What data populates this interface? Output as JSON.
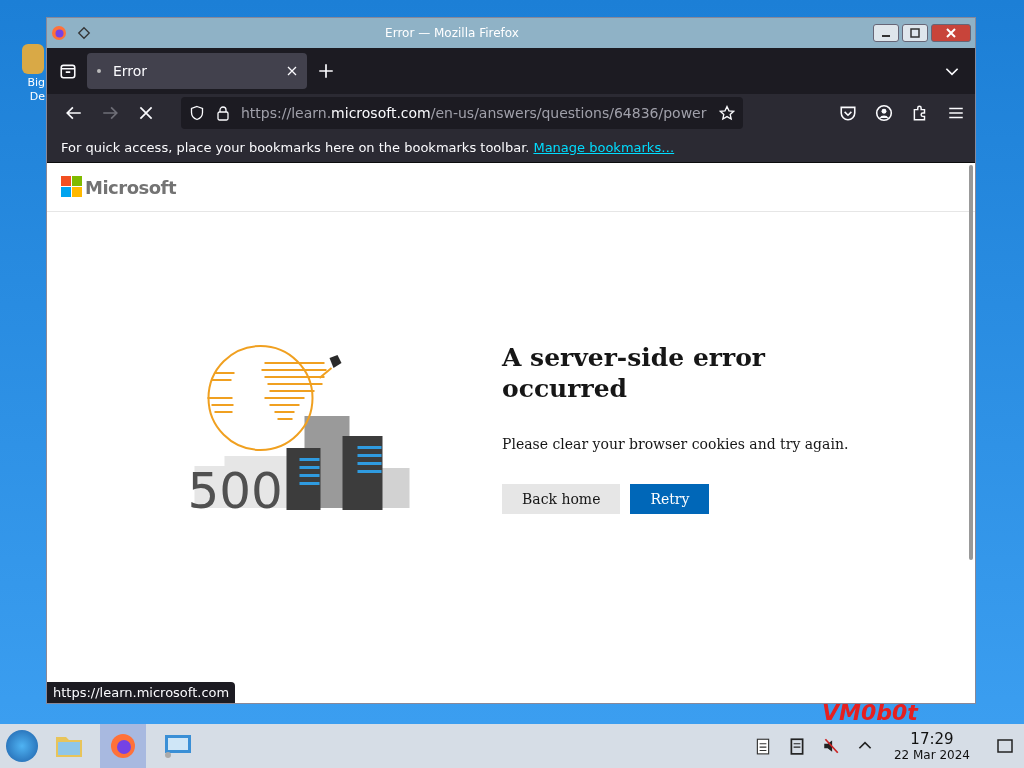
{
  "desktop": {
    "icon_label": [
      "Big",
      "De"
    ],
    "wallpaper_text": "VM0b0t"
  },
  "window": {
    "title": "Error — Mozilla Firefox"
  },
  "tabs": [
    {
      "label": "Error",
      "selected": true
    }
  ],
  "nav": {
    "forward_disabled": true,
    "loading": true,
    "url": {
      "prefix": "https://learn.",
      "domain": "microsoft.com",
      "path": "/en-us/answers/questions/64836/power"
    }
  },
  "bookmarks_bar": {
    "message": "For quick access, place your bookmarks here on the bookmarks toolbar.",
    "link": "Manage bookmarks…"
  },
  "page": {
    "logo": "Microsoft",
    "code": "500",
    "heading": "A server-side error occurred",
    "message": "Please clear your browser cookies and try again.",
    "buttons": [
      {
        "label": "Back home",
        "kind": "secondary"
      },
      {
        "label": "Retry",
        "kind": "primary"
      }
    ]
  },
  "status_link": "https://learn.microsoft.com",
  "taskbar": {
    "apps": [
      {
        "kind": "files",
        "selected": false
      },
      {
        "kind": "firefox",
        "selected": true
      },
      {
        "kind": "monitor",
        "selected": false
      }
    ],
    "time": "17:29",
    "date": "22 Mar 2024"
  }
}
